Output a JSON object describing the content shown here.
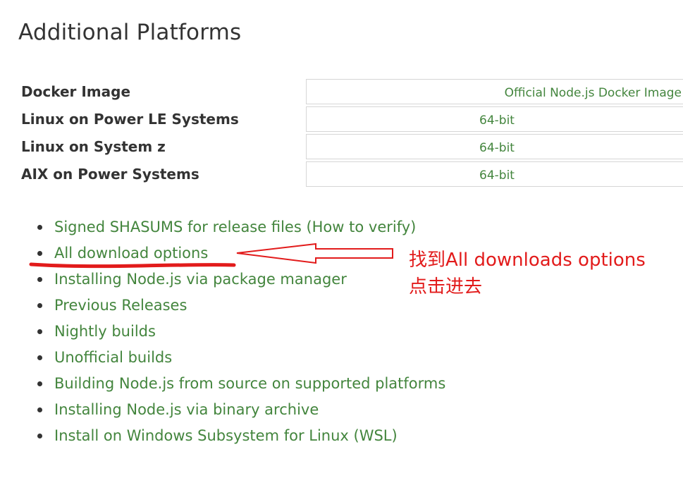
{
  "page": {
    "title": "Additional Platforms"
  },
  "platforms": [
    {
      "name": "Docker Image",
      "link": "Official Node.js Docker Image"
    },
    {
      "name": "Linux on Power LE Systems",
      "link": "64-bit"
    },
    {
      "name": "Linux on System z",
      "link": "64-bit"
    },
    {
      "name": "AIX on Power Systems",
      "link": "64-bit"
    }
  ],
  "links": {
    "signed_shasums": {
      "text": "Signed SHASUMS for release files",
      "paren_open": " (",
      "how_to_verify": "How to verify",
      "paren_close": ")"
    },
    "items": [
      "All download options",
      "Installing Node.js via package manager",
      "Previous Releases",
      "Nightly builds",
      "Unofficial builds",
      "Building Node.js from source on supported platforms",
      "Installing Node.js via binary archive",
      "Install on Windows Subsystem for Linux (WSL)"
    ]
  },
  "annotation": {
    "line1": "找到All downloads options",
    "line2": "点击进去",
    "color": "#e21b1b"
  },
  "colors": {
    "link": "#43853d",
    "text": "#333333",
    "border": "#d6d6d6"
  }
}
